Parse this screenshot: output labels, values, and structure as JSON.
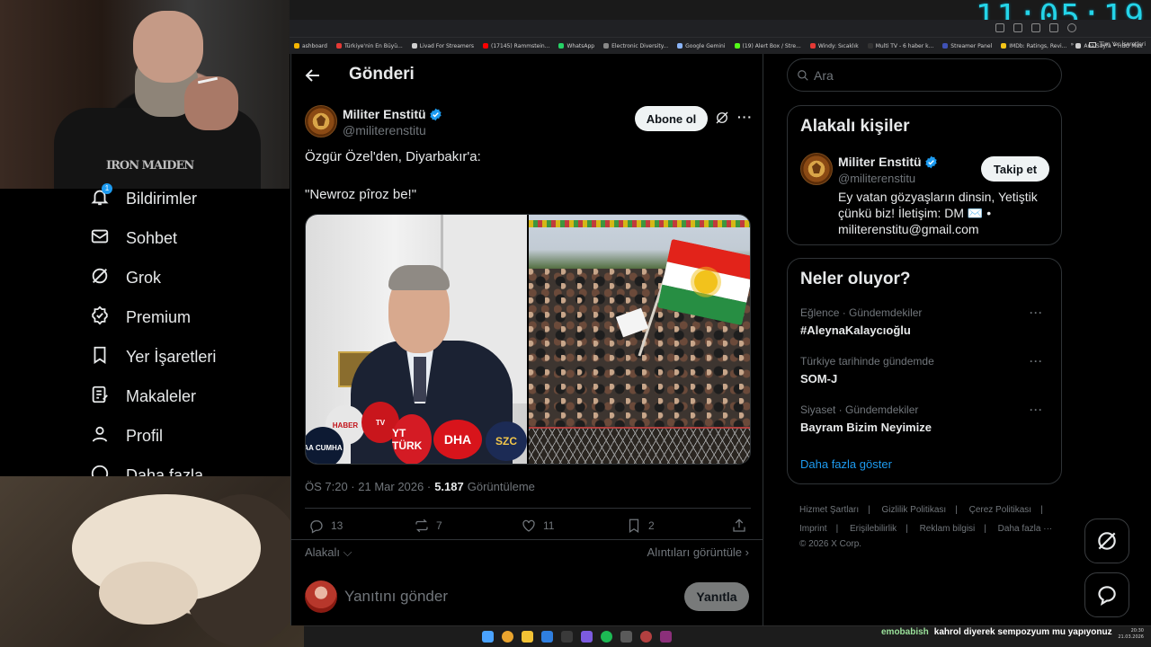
{
  "overlay": {
    "clock": "11:05:19"
  },
  "bookmarks": [
    {
      "label": "ashboard",
      "color": "#f4b400"
    },
    {
      "label": "Türkiye'nin En Büyü...",
      "color": "#e53935"
    },
    {
      "label": "Livad For Streamers",
      "color": "#cfcfcf"
    },
    {
      "label": "(17145) Rammstein...",
      "color": "#ff0000"
    },
    {
      "label": "WhatsApp",
      "color": "#25d366"
    },
    {
      "label": "Electronic Diversity...",
      "color": "#888888"
    },
    {
      "label": "Google Gemini",
      "color": "#8ab4f8"
    },
    {
      "label": "(19) Alert Box / Stre...",
      "color": "#53fc18"
    },
    {
      "label": "Windy: Sıcaklık",
      "color": "#e53935"
    },
    {
      "label": "Multi TV - 6 haber k...",
      "color": "#333333"
    },
    {
      "label": "Streamer Panel",
      "color": "#3f51b5"
    },
    {
      "label": "IMDb: Ratings, Revi...",
      "color": "#f5c518"
    },
    {
      "label": "Ana Sayfa • HBO Max",
      "color": "#cfcfcf"
    }
  ],
  "bookmarks_more": "»",
  "bookmarks_folder": "Tüm Yer İşaretleri",
  "nav": {
    "items": [
      {
        "label": "Bildirimler",
        "icon": "bell-icon",
        "badge": "1"
      },
      {
        "label": "Sohbet",
        "icon": "mail-icon"
      },
      {
        "label": "Grok",
        "icon": "grok-icon"
      },
      {
        "label": "Premium",
        "icon": "premium-icon"
      },
      {
        "label": "Yer İşaretleri",
        "icon": "bookmark-icon"
      },
      {
        "label": "Makaleler",
        "icon": "article-icon"
      },
      {
        "label": "Profil",
        "icon": "person-icon"
      },
      {
        "label": "Daha fazla",
        "icon": "more-icon"
      }
    ]
  },
  "header": {
    "title": "Gönderi"
  },
  "post": {
    "author": "Militer Enstitü",
    "handle": "@militerenstitu",
    "follow_label": "Abone ol",
    "line1": "Özgür Özel'den, Diyarbakır'a:",
    "line2": "\"Newroz pîroz be!\"",
    "time": "ÖS 7:20 · 21 Mar 2026 ·",
    "views": "5.187",
    "views_label": "Görüntüleme",
    "media_mics": [
      "HABER",
      "TV",
      "AA CUMHA",
      "YT TÜRK",
      "DHA",
      "SZC"
    ],
    "stats": {
      "replies": "13",
      "reposts": "7",
      "likes": "11",
      "bookmarks": "2"
    },
    "related": "Alakalı",
    "quotes": "Alıntıları görüntüle"
  },
  "reply": {
    "placeholder": "Yanıtını gönder",
    "button": "Yanıtla"
  },
  "search": {
    "placeholder": "Ara"
  },
  "related_people": {
    "title": "Alakalı kişiler",
    "name": "Militer Enstitü",
    "handle": "@militerenstitu",
    "follow_label": "Takip et",
    "bio": "Ey vatan gözyaşların dinsin, Yetiştik çünkü biz! İletişim: DM ✉️ • militerenstitu@gmail.com"
  },
  "trends": {
    "title": "Neler oluyor?",
    "items": [
      {
        "category": "Eğlence · Gündemdekiler",
        "name": "#AleynaKalaycıoğlu"
      },
      {
        "category": "Türkiye tarihinde gündemde",
        "name": "SOM-J"
      },
      {
        "category": "Siyaset · Gündemdekiler",
        "name": "Bayram Bizim Neyimize"
      }
    ],
    "show_more": "Daha fazla göster"
  },
  "footer": {
    "links": [
      "Hizmet Şartları",
      "|",
      "Gizlilik Politikası",
      "|",
      "Çerez Politikası",
      "|",
      "Imprint",
      "|",
      "Erişilebilirlik",
      "|",
      "Reklam bilgisi",
      "|",
      "Daha fazla ···"
    ],
    "copyright": "© 2026 X Corp."
  },
  "chat": {
    "user": "emobabish",
    "message": "kahrol diyerek sempozyum mu yapıyonuz"
  },
  "tray": {
    "time": "20:30",
    "date": "21.03.2026"
  },
  "colors": {
    "accent": "#1d9bf0",
    "clock": "#24d4e8",
    "kurdish_flag": [
      "#e2231a",
      "#ffffff",
      "#278e43"
    ]
  }
}
